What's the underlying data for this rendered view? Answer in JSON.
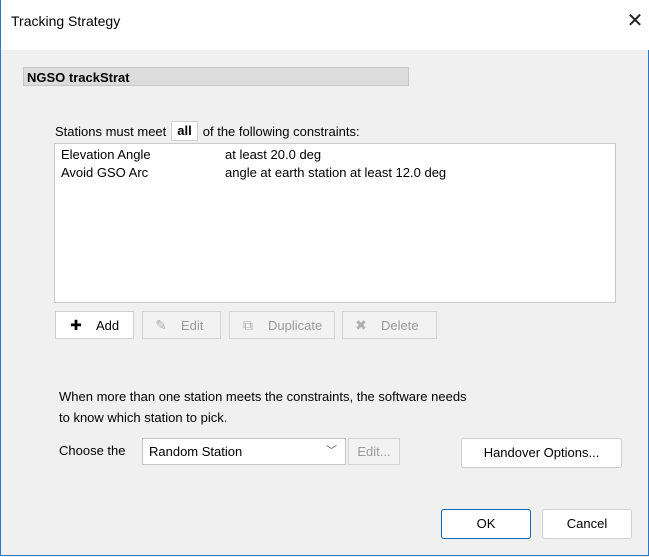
{
  "window": {
    "title": "Tracking Strategy",
    "close_glyph": "✕"
  },
  "name_field": {
    "value": "NGSO trackStrat"
  },
  "constraints": {
    "prefix": "Stations must meet",
    "mode": "all",
    "suffix": "of the following constraints:",
    "rows": [
      {
        "name": "Elevation Angle",
        "value": "at least 20.0 deg"
      },
      {
        "name": "Avoid GSO Arc",
        "value": "angle at earth station at least 12.0 deg"
      }
    ]
  },
  "list_buttons": {
    "add": {
      "label": "Add",
      "icon": "plus-icon",
      "glyph": "✚"
    },
    "edit": {
      "label": "Edit",
      "icon": "pencil-icon",
      "glyph": "✎"
    },
    "duplicate": {
      "label": "Duplicate",
      "icon": "duplicate-icon",
      "glyph": "⧉"
    },
    "delete": {
      "label": "Delete",
      "icon": "x-icon",
      "glyph": "✖"
    }
  },
  "selection": {
    "info_line1": "When more than one station meets the constraints, the software needs",
    "info_line2": "to know which station to pick.",
    "choose_label": "Choose the",
    "selected": "Random Station",
    "dropdown_glyph": "﹀",
    "edit_label": "Edit...",
    "handover_label": "Handover Options..."
  },
  "footer": {
    "ok_label": "OK",
    "cancel_label": "Cancel"
  },
  "colors": {
    "border_accent": "#2b78c5",
    "primary_button": "#0f66c2"
  }
}
